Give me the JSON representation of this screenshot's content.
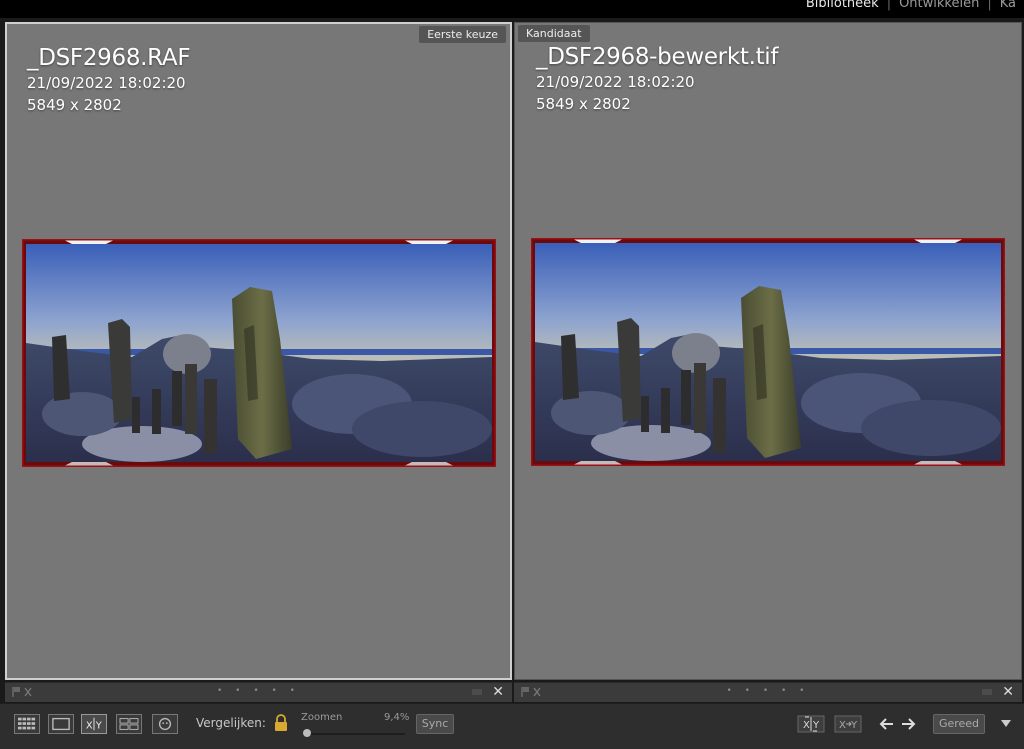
{
  "modules": {
    "items": [
      "Bibliotheek",
      "Ontwikkelen",
      "Ka"
    ],
    "active": 0
  },
  "left": {
    "tag": "Eerste keuze",
    "filename": "_DSF2968.RAF",
    "datetime": "21/09/2022 18:02:20",
    "dimensions": "5849 x 2802"
  },
  "right": {
    "tag": "Kandidaat",
    "filename": "_DSF2968-bewerkt.tif",
    "datetime": "21/09/2022 18:02:20",
    "dimensions": "5849 x 2802"
  },
  "footer": {
    "dots": "• • • • •",
    "close": "✕"
  },
  "toolbar": {
    "compare_label": "Vergelijken:",
    "zoom_label": "Zoomen",
    "zoom_value": "9,4%",
    "sync_label": "Sync",
    "done_label": "Gereed",
    "xy_label": "X|Y"
  },
  "colors": {
    "pane": "#777777",
    "accent_border": "#cfcfcf",
    "frame_red": "#8e0e10"
  }
}
